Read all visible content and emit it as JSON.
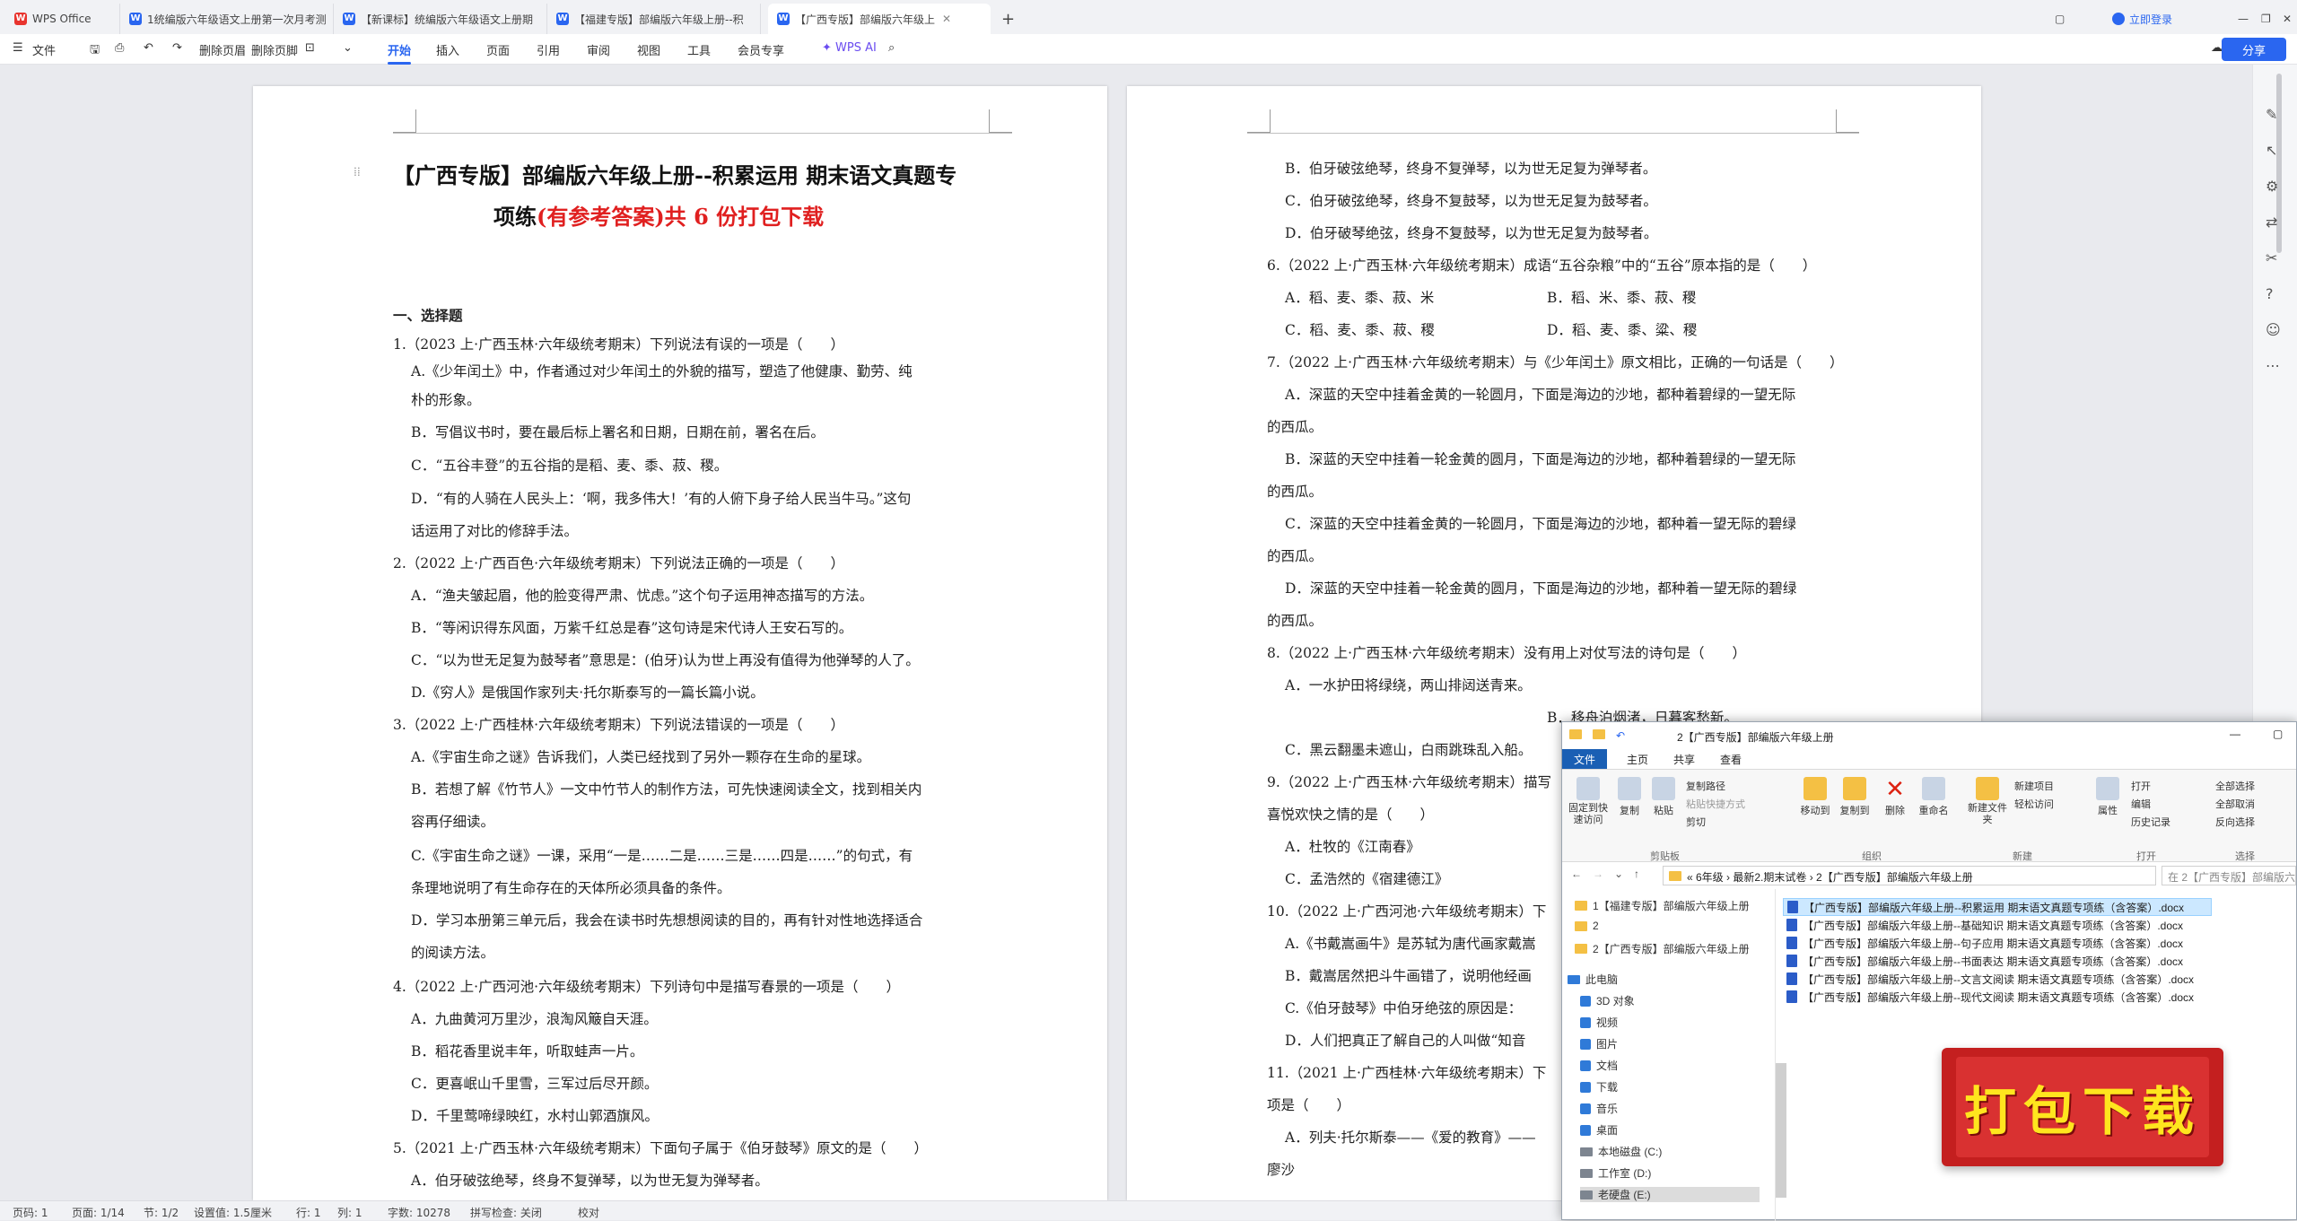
{
  "tabs": [
    {
      "label": "WPS Office"
    },
    {
      "label": "1统编版六年级语文上册第一次月考测"
    },
    {
      "label": "【新课标】统编版六年级语文上册期"
    },
    {
      "label": "【福建专版】部编版六年级上册--积"
    },
    {
      "label": "【广西专版】部编版六年级上"
    }
  ],
  "window": {
    "login": "立即登录",
    "share": "分享"
  },
  "toolbar": {
    "file": "文件",
    "delete_page": "删除页眉",
    "delete_footer": "删除页脚",
    "wps_ai": "WPS AI"
  },
  "ribbon_tabs": [
    "开始",
    "插入",
    "页面",
    "引用",
    "审阅",
    "视图",
    "工具",
    "会员专享"
  ],
  "doc_left": {
    "title1": "【广西专版】部编版六年级上册--积累运用 期末语文真题专",
    "title2a": "项练",
    "title2b": "(有参考答案)共 6 份打包下载",
    "lines": [
      "一、选择题",
      "1.（2023 上·广西玉林·六年级统考期末）下列说法有误的一项是（　　）",
      "A.《少年闰土》中，作者通过对少年闰土的外貌的描写，塑造了他健康、勤劳、纯",
      "朴的形象。",
      "B．写倡议书时，要在最后标上署名和日期，日期在前，署名在后。",
      "C．“五谷丰登”的五谷指的是稻、麦、黍、菽、稷。",
      "D．“有的人骑在人民头上：‘啊，我多伟大！’有的人俯下身子给人民当牛马。”这句",
      "话运用了对比的修辞手法。",
      "2.（2022 上·广西百色·六年级统考期末）下列说法正确的一项是（　　）",
      "A．“渔夫皱起眉，他的脸变得严肃、忧虑。”这个句子运用神态描写的方法。",
      "B．“等闲识得东风面，万紫千红总是春”这句诗是宋代诗人王安石写的。",
      "C．“以为世无足复为鼓琴者”意思是：(伯牙)认为世上再没有值得为他弹琴的人了。",
      "D.《穷人》是俄国作家列夫·托尔斯泰写的一篇长篇小说。",
      "3.（2022 上·广西桂林·六年级统考期末）下列说法错误的一项是（　　）",
      "A.《宇宙生命之谜》告诉我们，人类已经找到了另外一颗存在生命的星球。",
      "B．若想了解《竹节人》一文中竹节人的制作方法，可先快速阅读全文，找到相关内",
      "容再仔细读。",
      "C.《宇宙生命之谜》一课，采用“一是……二是……三是……四是……”的句式，有",
      "条理地说明了有生命存在的天体所必须具备的条件。",
      "D．学习本册第三单元后，我会在读书时先想想阅读的目的，再有针对性地选择适合",
      "的阅读方法。",
      "4.（2022 上·广西河池·六年级统考期末）下列诗句中是描写春景的一项是（　　）",
      "A．九曲黄河万里沙，浪淘风簸自天涯。",
      "B．稻花香里说丰年，听取蛙声一片。",
      "C．更喜岷山千里雪，三军过后尽开颜。",
      "D．千里莺啼绿映红，水村山郭酒旗风。",
      "5.（2021 上·广西玉林·六年级统考期末）下面句子属于《伯牙鼓琴》原文的是（　　）",
      "A．伯牙破弦绝琴，终身不复弹琴，以为世无复为弹琴者。"
    ]
  },
  "doc_right": {
    "lines": [
      "B．伯牙破弦绝琴，终身不复弹琴，以为世无足复为弹琴者。",
      "C．伯牙破弦绝琴，终身不复鼓琴，以为世无足复为鼓琴者。",
      "D．伯牙破琴绝弦，终身不复鼓琴，以为世无足复为鼓琴者。",
      "6.（2022 上·广西玉林·六年级统考期末）成语“五谷杂粮”中的“五谷”原本指的是（　　）",
      "A．稻、麦、黍、菽、米",
      "B．稻、米、黍、菽、稷",
      "C．稻、麦、黍、菽、稷",
      "D．稻、麦、黍、粱、稷",
      "7.（2022 上·广西玉林·六年级统考期末）与《少年闰土》原文相比，正确的一句话是（　　）",
      "A．深蓝的天空中挂着金黄的一轮圆月，下面是海边的沙地，都种着碧绿的一望无际",
      "的西瓜。",
      "B．深蓝的天空中挂着一轮金黄的圆月，下面是海边的沙地，都种着碧绿的一望无际",
      "的西瓜。",
      "C．深蓝的天空中挂着金黄的一轮圆月，下面是海边的沙地，都种着一望无际的碧绿",
      "的西瓜。",
      "D．深蓝的天空中挂着一轮金黄的圆月，下面是海边的沙地，都种着一望无际的碧绿",
      "的西瓜。",
      "8.（2022 上·广西玉林·六年级统考期末）没有用上对仗写法的诗句是（　　）",
      "A．一水护田将绿绕，两山排闼送青来。",
      "B．移舟泊烟渚，日暮客愁新。",
      "C．黑云翻墨未遮山，白雨跳珠乱入船。",
      "9.（2022 上·广西玉林·六年级统考期末）描写",
      "喜悦欢快之情的是（　　）",
      "A．杜牧的《江南春》",
      "C．孟浩然的《宿建德江》",
      "10.（2022 上·广西河池·六年级统考期末）下",
      "A.《书戴嵩画牛》是苏轼为唐代画家戴嵩",
      "B．戴嵩居然把斗牛画错了，说明他经画",
      "C.《伯牙鼓琴》中伯牙绝弦的原因是：",
      "D．人们把真正了解自己的人叫做“知音",
      "11.（2021 上·广西桂林·六年级统考期末）下",
      "项是（　　）",
      "A．列夫·托尔斯泰——《爱的教育》——",
      "廖沙"
    ]
  },
  "statusbar": {
    "page": "页码: 1",
    "pages": "页面: 1/14",
    "section": "节: 1/2",
    "setting": "设置值: 1.5厘米",
    "row": "行: 1",
    "col": "列: 1",
    "words": "字数: 10278",
    "spell": "拼写检查: 关闭",
    "proof": "校对"
  },
  "explorer": {
    "title": "2【广西专版】部编版六年级上册",
    "tabs": [
      "文件",
      "主页",
      "共享",
      "查看"
    ],
    "ribbon": {
      "pin": "固定到快速访问",
      "copy": "复制",
      "paste": "粘贴",
      "copy_path": "复制路径",
      "paste_shortcut": "粘贴快捷方式",
      "cut": "剪切",
      "move_to": "移动到",
      "copy_to": "复制到",
      "delete": "删除",
      "rename": "重命名",
      "new_folder": "新建文件夹",
      "new_item": "新建项目",
      "easy_access": "轻松访问",
      "properties": "属性",
      "open": "打开",
      "edit": "编辑",
      "history": "历史记录",
      "select_all": "全部选择",
      "select_none": "全部取消",
      "invert": "反向选择",
      "g_clipboard": "剪贴板",
      "g_organize": "组织",
      "g_new": "新建",
      "g_open": "打开",
      "g_select": "选择"
    },
    "address": "«  6年级  ›  最新2.期末试卷  ›  2【广西专版】部编版六年级上册",
    "search": "在 2【广西专版】部编版六年级上...",
    "nav": [
      "1【福建专版】部编版六年级上册",
      "2",
      "2【广西专版】部编版六年级上册",
      "此电脑",
      "3D 对象",
      "视频",
      "图片",
      "文档",
      "下载",
      "音乐",
      "桌面",
      "本地磁盘 (C:)",
      "工作室 (D:)",
      "老硬盘 (E:)"
    ],
    "files": [
      "【广西专版】部编版六年级上册--积累运用 期末语文真题专项练（含答案）.docx",
      "【广西专版】部编版六年级上册--基础知识 期末语文真题专项练（含答案）.docx",
      "【广西专版】部编版六年级上册--句子应用 期末语文真题专项练（含答案）.docx",
      "【广西专版】部编版六年级上册--书面表达 期末语文真题专项练（含答案）.docx",
      "【广西专版】部编版六年级上册--文言文阅读 期末语文真题专项练（含答案）.docx",
      "【广西专版】部编版六年级上册--现代文阅读 期末语文真题专项练（含答案）.docx"
    ]
  },
  "stamp": {
    "text": "打包下载"
  },
  "colors": {
    "accent": "#2a66f0",
    "title_red": "#e02020",
    "stamp": "#c41f1f"
  }
}
